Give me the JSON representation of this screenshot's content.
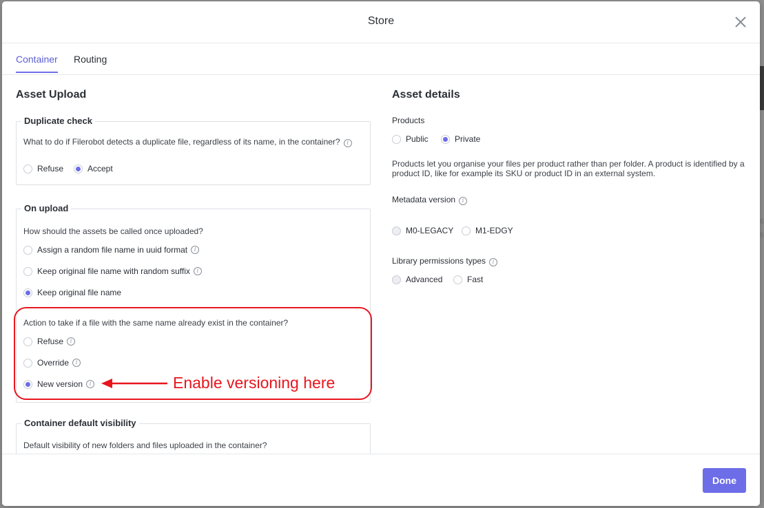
{
  "modal": {
    "title": "Store",
    "close_icon": "close-icon"
  },
  "tabs": [
    {
      "label": "Container",
      "active": true
    },
    {
      "label": "Routing",
      "active": false
    }
  ],
  "asset_upload": {
    "title": "Asset Upload",
    "duplicate_check": {
      "legend": "Duplicate check",
      "question": "What to do if Filerobot detects a duplicate file, regardless of its name, in the container?",
      "options": [
        {
          "label": "Refuse",
          "checked": false
        },
        {
          "label": "Accept",
          "checked": true
        }
      ]
    },
    "on_upload": {
      "legend": "On upload",
      "naming_question": "How should the assets be called once uploaded?",
      "naming_options": [
        {
          "label": "Assign a random file name in uuid format",
          "checked": false,
          "info": true
        },
        {
          "label": "Keep original file name with random suffix",
          "checked": false,
          "info": true
        },
        {
          "label": "Keep original file name",
          "checked": true,
          "info": false
        }
      ],
      "conflict_question": "Action to take if a file with the same name already exist in the container?",
      "conflict_options": [
        {
          "label": "Refuse",
          "checked": false,
          "info": true
        },
        {
          "label": "Override",
          "checked": false,
          "info": true
        },
        {
          "label": "New version",
          "checked": true,
          "info": true
        }
      ]
    },
    "default_visibility": {
      "legend": "Container default visibility",
      "question": "Default visibility of new folders and files uploaded in the container?"
    }
  },
  "asset_details": {
    "title": "Asset details",
    "products": {
      "label": "Products",
      "options": [
        {
          "label": "Public",
          "checked": false
        },
        {
          "label": "Private",
          "checked": true
        }
      ],
      "description": "Products let you organise your files per product rather than per folder. A product is identified by a product ID, like for example its SKU or product ID in an external system."
    },
    "metadata_version": {
      "label": "Metadata version",
      "options": [
        {
          "label": "M0-LEGACY",
          "checked": false,
          "disabled": true
        },
        {
          "label": "M1-EDGY",
          "checked": false,
          "disabled": false
        }
      ]
    },
    "library_permissions": {
      "label": "Library permissions types",
      "options": [
        {
          "label": "Advanced",
          "checked": false,
          "disabled": true
        },
        {
          "label": "Fast",
          "checked": false,
          "disabled": false
        }
      ]
    }
  },
  "annotation": {
    "text": "Enable versioning here",
    "color": "#e8151d"
  },
  "footer": {
    "done_label": "Done"
  },
  "colors": {
    "accent": "#6d6de8"
  }
}
